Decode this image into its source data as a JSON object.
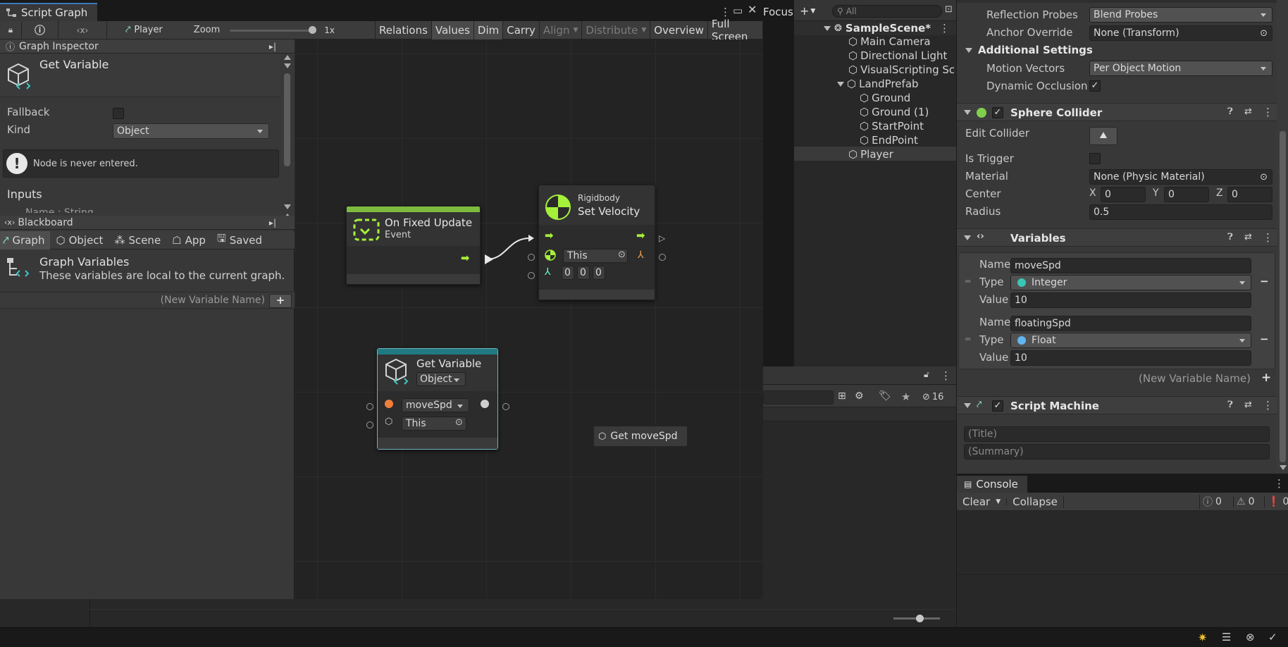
{
  "window": {
    "tab_title": "Script Graph",
    "toolbar": {
      "player_label": "Player",
      "zoom_label": "Zoom",
      "zoom_value": "1x",
      "buttons": [
        "Relations",
        "Values",
        "Dim",
        "Carry",
        "Align",
        "Distribute",
        "Overview",
        "Full Screen"
      ],
      "focus_label": "Focus"
    }
  },
  "graph_inspector": {
    "title": "Graph Inspector",
    "node_title": "Get Variable",
    "fallback_label": "Fallback",
    "kind_label": "Kind",
    "kind_value": "Object",
    "warning": "Node is never entered.",
    "inputs_label": "Inputs",
    "input_cutoff": "Name : String"
  },
  "blackboard": {
    "title": "Blackboard",
    "tabs": [
      "Graph",
      "Object",
      "Scene",
      "App",
      "Saved"
    ],
    "section_title": "Graph Variables",
    "section_desc": "These variables are local to the current graph.",
    "new_var_placeholder": "(New Variable Name)"
  },
  "nodes": {
    "fixed_update": {
      "title": "On Fixed Update",
      "subtitle": "Event"
    },
    "set_velocity": {
      "category": "Rigidbody",
      "title": "Set Velocity",
      "target": "This",
      "vx": "0",
      "vy": "0",
      "vz": "0"
    },
    "get_variable": {
      "title": "Get Variable",
      "kind": "Object",
      "name": "moveSpd",
      "target": "This"
    },
    "tooltip": "Get moveSpd"
  },
  "hierarchy": {
    "search_placeholder": "All",
    "scene": "SampleScene*",
    "items": [
      {
        "label": "Main Camera",
        "depth": 1
      },
      {
        "label": "Directional Light",
        "depth": 1
      },
      {
        "label": "VisualScripting Sc",
        "depth": 1
      },
      {
        "label": "LandPrefab",
        "depth": 1
      },
      {
        "label": "Ground",
        "depth": 2
      },
      {
        "label": "Ground (1)",
        "depth": 2
      },
      {
        "label": "StartPoint",
        "depth": 2
      },
      {
        "label": "EndPoint",
        "depth": 2
      },
      {
        "label": "Player",
        "depth": 1
      }
    ],
    "hidden_count": "16"
  },
  "inspector": {
    "reflection_probes_label": "Reflection Probes",
    "reflection_probes_value": "Blend Probes",
    "anchor_override_label": "Anchor Override",
    "anchor_override_value": "None (Transform)",
    "additional_settings": "Additional Settings",
    "motion_vectors_label": "Motion Vectors",
    "motion_vectors_value": "Per Object Motion",
    "dynamic_occlusion_label": "Dynamic Occlusion",
    "sphere_collider": {
      "title": "Sphere Collider",
      "edit_collider": "Edit Collider",
      "is_trigger": "Is Trigger",
      "material_label": "Material",
      "material_value": "None (Physic Material)",
      "center_label": "Center",
      "x": "0",
      "y": "0",
      "z": "0",
      "radius_label": "Radius",
      "radius_value": "0.5"
    },
    "variables": {
      "title": "Variables",
      "name_label": "Name",
      "type_label": "Type",
      "value_label": "Value",
      "var1": {
        "name": "moveSpd",
        "type": "Integer",
        "value": "10"
      },
      "var2": {
        "name": "floatingSpd",
        "type": "Float",
        "value": "10"
      },
      "new_var_placeholder": "(New Variable Name)"
    },
    "script_machine": {
      "title": "Script Machine",
      "title_placeholder": "(Title)",
      "summary_placeholder": "(Summary)"
    }
  },
  "console": {
    "tab": "Console",
    "clear": "Clear",
    "collapse": "Collapse",
    "info_count": "0",
    "warn_count": "0",
    "error_count": "0"
  },
  "colors": {
    "flow_green": "#a5f03a",
    "teal_header": "#1f7a82",
    "event_header": "#7dbb3f",
    "integer_dot": "#39c6b5",
    "float_dot": "#62b6f0"
  }
}
